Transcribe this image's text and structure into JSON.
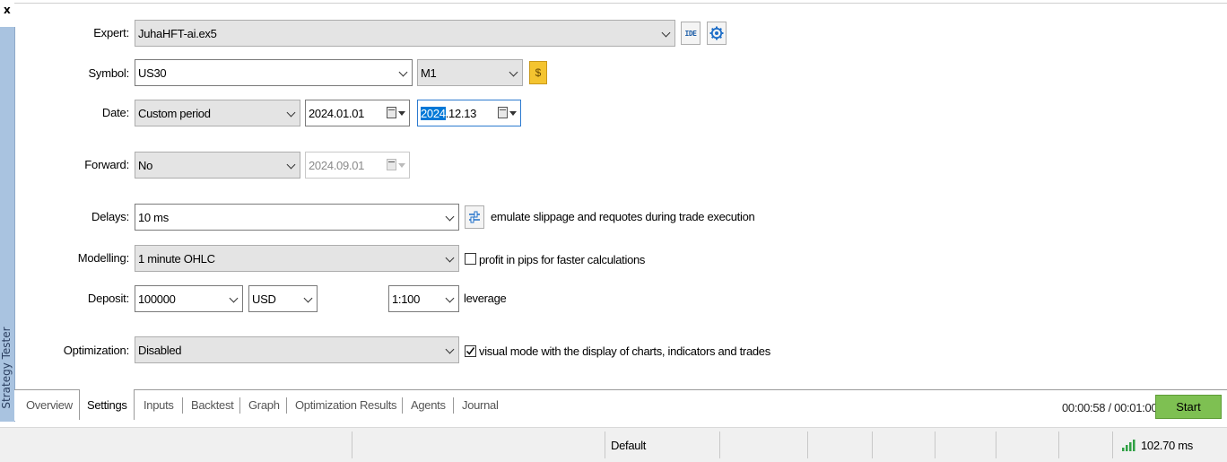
{
  "window": {
    "close_glyph": "x",
    "side_title": "Strategy Tester"
  },
  "form": {
    "expert": {
      "label": "Expert:",
      "value": "JuhaHFT-ai.ex5",
      "ide_label": "IDE",
      "settings_icon": "gear-icon"
    },
    "symbol": {
      "label": "Symbol:",
      "value": "US30",
      "timeframe": "M1",
      "symbol_spec_icon": "dollar-icon",
      "symbol_spec_glyph": "$"
    },
    "date": {
      "label": "Date:",
      "mode": "Custom period",
      "from": "2024.01.01",
      "to_selected": "2024",
      "to_rest": ".12.13"
    },
    "forward": {
      "label": "Forward:",
      "value": "No",
      "date": "2024.09.01"
    },
    "delays": {
      "label": "Delays:",
      "value": "10 ms",
      "slippage_text": "emulate slippage and requotes during trade execution"
    },
    "modelling": {
      "label": "Modelling:",
      "value": "1 minute OHLC",
      "pips_checkbox_label": "profit in pips for faster calculations",
      "pips_checked": false
    },
    "deposit": {
      "label": "Deposit:",
      "amount": "100000",
      "currency": "USD",
      "leverage": "1:100",
      "leverage_label": "leverage"
    },
    "optimization": {
      "label": "Optimization:",
      "value": "Disabled",
      "visual_label": "visual mode with the display of charts, indicators and trades",
      "visual_checked": true
    }
  },
  "tabs": [
    "Overview",
    "Settings",
    "Inputs",
    "Backtest",
    "Graph",
    "Optimization Results",
    "Agents",
    "Journal"
  ],
  "active_tab": "Settings",
  "timer": "00:00:58 / 00:01:00",
  "start_label": "Start",
  "statusbar": {
    "profile": "Default",
    "ping": "102.70 ms"
  },
  "colors": {
    "start_button": "#7ec052",
    "side_strip": "#a9c3e0",
    "date_highlight": "#0078d7",
    "spec_icon": "#f4c430"
  }
}
